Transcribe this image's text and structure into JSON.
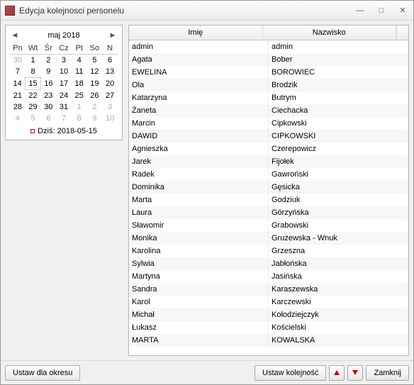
{
  "window": {
    "title": "Edycja kolejnosci personelu"
  },
  "calendar": {
    "title": "maj 2018",
    "dow": [
      "Pn",
      "Wt",
      "Śr",
      "Cz",
      "Pt",
      "So",
      "N"
    ],
    "weeks": [
      [
        {
          "d": "30",
          "o": true
        },
        {
          "d": "1"
        },
        {
          "d": "2"
        },
        {
          "d": "3"
        },
        {
          "d": "4"
        },
        {
          "d": "5"
        },
        {
          "d": "6"
        }
      ],
      [
        {
          "d": "7"
        },
        {
          "d": "8"
        },
        {
          "d": "9"
        },
        {
          "d": "10"
        },
        {
          "d": "11"
        },
        {
          "d": "12"
        },
        {
          "d": "13"
        }
      ],
      [
        {
          "d": "14"
        },
        {
          "d": "15",
          "sel": true
        },
        {
          "d": "16"
        },
        {
          "d": "17"
        },
        {
          "d": "18"
        },
        {
          "d": "19"
        },
        {
          "d": "20"
        }
      ],
      [
        {
          "d": "21"
        },
        {
          "d": "22"
        },
        {
          "d": "23"
        },
        {
          "d": "24"
        },
        {
          "d": "25"
        },
        {
          "d": "26"
        },
        {
          "d": "27"
        }
      ],
      [
        {
          "d": "28"
        },
        {
          "d": "29"
        },
        {
          "d": "30"
        },
        {
          "d": "31"
        },
        {
          "d": "1",
          "o": true
        },
        {
          "d": "2",
          "o": true
        },
        {
          "d": "3",
          "o": true
        }
      ],
      [
        {
          "d": "4",
          "o": true
        },
        {
          "d": "5",
          "o": true
        },
        {
          "d": "6",
          "o": true
        },
        {
          "d": "7",
          "o": true
        },
        {
          "d": "8",
          "o": true
        },
        {
          "d": "9",
          "o": true
        },
        {
          "d": "10",
          "o": true
        }
      ]
    ],
    "today_label": "Dziś: 2018-05-15"
  },
  "grid": {
    "columns": [
      "Imię",
      "Nazwisko"
    ],
    "rows": [
      {
        "first": "admin",
        "last": "admin"
      },
      {
        "first": "Agata",
        "last": "Bober"
      },
      {
        "first": "EWELINA",
        "last": "BOROWIEC"
      },
      {
        "first": "Ola",
        "last": "Brodzik"
      },
      {
        "first": "Katarzyna",
        "last": "Butrym"
      },
      {
        "first": "Żaneta",
        "last": "Ciechacka"
      },
      {
        "first": "Marcin",
        "last": "Cipkowski"
      },
      {
        "first": "DAWID",
        "last": "CIPKOWSKI"
      },
      {
        "first": "Agnieszka",
        "last": "Czerepowicz"
      },
      {
        "first": "Jarek",
        "last": "Fijołek"
      },
      {
        "first": "Radek",
        "last": "Gawroński"
      },
      {
        "first": "Dominika",
        "last": "Gęsicka"
      },
      {
        "first": "Marta",
        "last": "Godziuk"
      },
      {
        "first": "Laura",
        "last": "Górzyńska"
      },
      {
        "first": "Sławomir",
        "last": "Grabowski"
      },
      {
        "first": "Monika",
        "last": "Grużewska - Wnuk"
      },
      {
        "first": "Karolina",
        "last": "Grzeszna"
      },
      {
        "first": "Sylwia",
        "last": "Jabłońska"
      },
      {
        "first": "Martyna",
        "last": "Jasińska"
      },
      {
        "first": "Sandra",
        "last": "Karaszewska"
      },
      {
        "first": "Karol",
        "last": "Karczewski"
      },
      {
        "first": "Michał",
        "last": "Kołodziejczyk"
      },
      {
        "first": "Łukasz",
        "last": "Kościelski"
      },
      {
        "first": "MARTA",
        "last": "KOWALSKA"
      }
    ]
  },
  "footer": {
    "period_btn": "Ustaw dla okresu",
    "order_btn": "Ustaw kolejność",
    "close_btn": "Zamknij"
  }
}
